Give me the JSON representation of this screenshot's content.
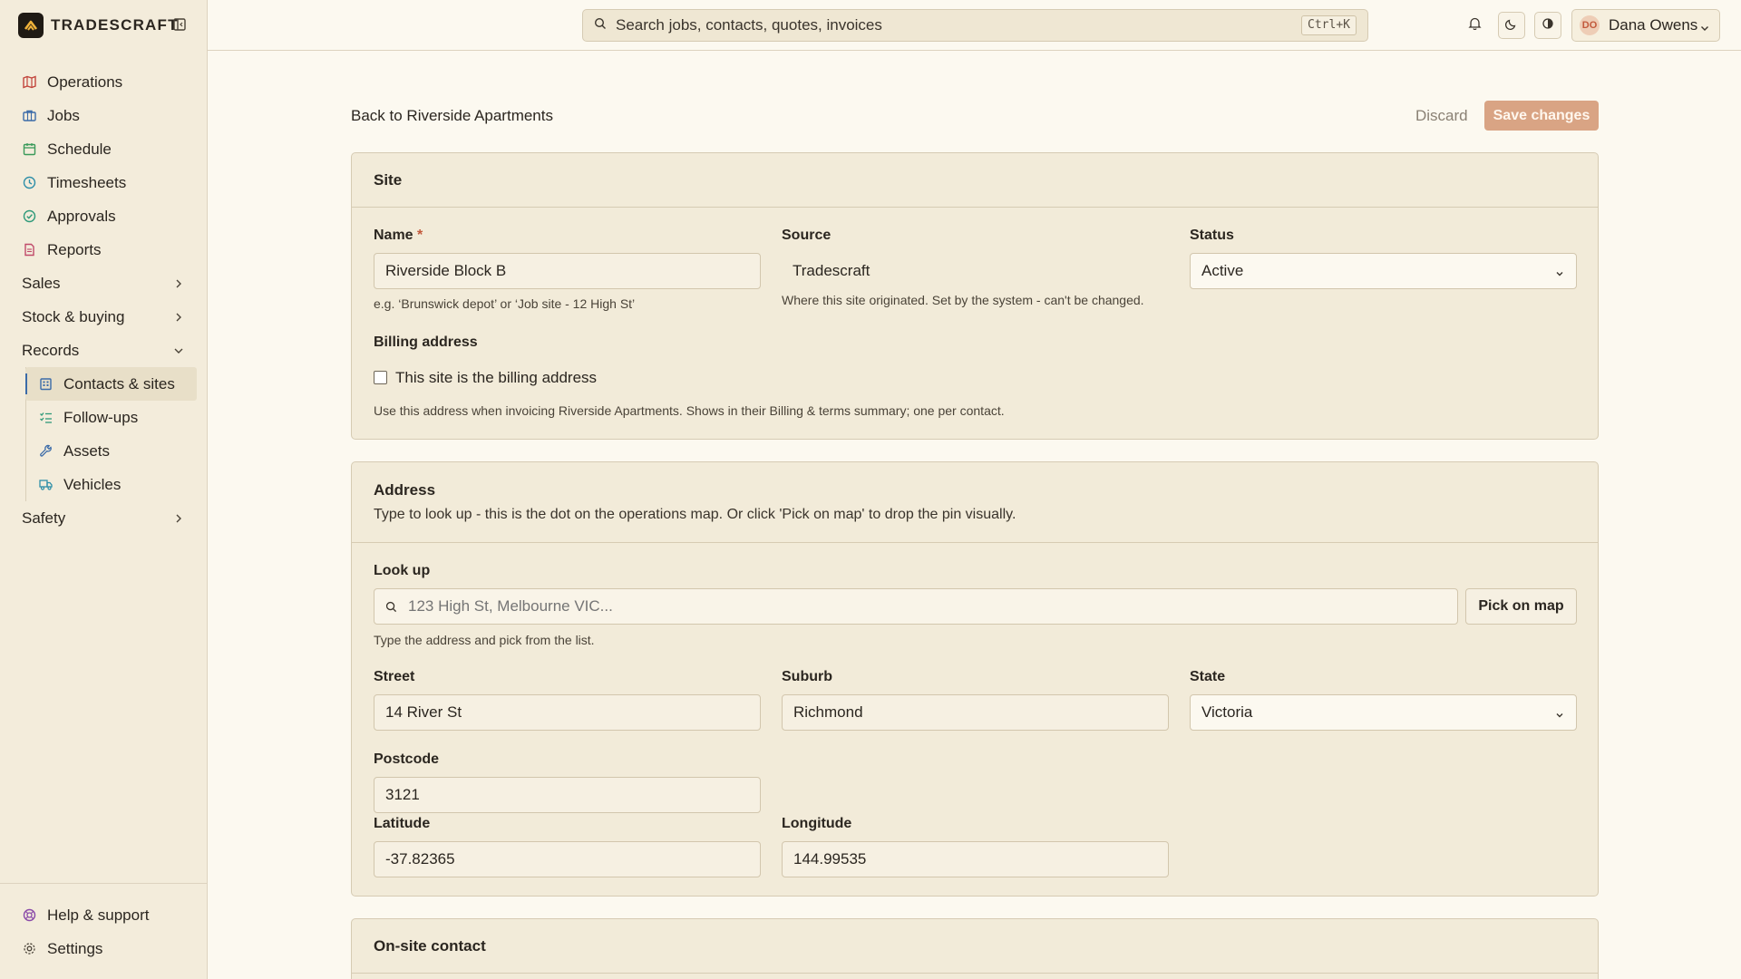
{
  "brand": {
    "name": "TRADESCRAFT"
  },
  "sidebar": {
    "items": [
      {
        "label": "Operations",
        "icon": "map-icon",
        "color": "#c2453c"
      },
      {
        "label": "Jobs",
        "icon": "briefcase-icon",
        "color": "#3b6ba8"
      },
      {
        "label": "Schedule",
        "icon": "calendar-icon",
        "color": "#3a9a5a"
      },
      {
        "label": "Timesheets",
        "icon": "clock-icon",
        "color": "#2f8fa8"
      },
      {
        "label": "Approvals",
        "icon": "check-circle-icon",
        "color": "#2f9a7a"
      },
      {
        "label": "Reports",
        "icon": "report-icon",
        "color": "#c04a6a"
      }
    ],
    "groups": {
      "sales": "Sales",
      "stock": "Stock & buying",
      "records": "Records",
      "safety": "Safety"
    },
    "records_items": [
      {
        "label": "Contacts & sites",
        "icon": "building-icon"
      },
      {
        "label": "Follow-ups",
        "icon": "checklist-icon"
      },
      {
        "label": "Assets",
        "icon": "wrench-icon"
      },
      {
        "label": "Vehicles",
        "icon": "truck-icon"
      }
    ],
    "bottom": {
      "help": "Help & support",
      "settings": "Settings"
    }
  },
  "topbar": {
    "search_placeholder": "Search jobs, contacts, quotes, invoices",
    "shortcut": "Ctrl+K",
    "user": {
      "initials": "DO",
      "name": "Dana Owens"
    }
  },
  "page": {
    "back_label": "Back to Riverside Apartments",
    "discard_label": "Discard",
    "save_label": "Save changes"
  },
  "site": {
    "title": "Site",
    "name_label": "Name",
    "required_mark": "*",
    "name_value": "Riverside Block B",
    "name_hint": "e.g. ‘Brunswick depot’ or ‘Job site - 12 High St’",
    "source_label": "Source",
    "source_value": "Tradescraft",
    "source_hint": "Where this site originated. Set by the system - can't be changed.",
    "status_label": "Status",
    "status_value": "Active",
    "billing_label": "Billing address",
    "billing_checkbox": "This site is the billing address",
    "billing_hint": "Use this address when invoicing Riverside Apartments. Shows in their Billing & terms summary; one per contact."
  },
  "address": {
    "title": "Address",
    "description": "Type to look up - this is the dot on the operations map. Or click 'Pick on map' to drop the pin visually.",
    "lookup_label": "Look up",
    "lookup_placeholder": "123 High St, Melbourne VIC...",
    "pick_label": "Pick on map",
    "lookup_hint": "Type the address and pick from the list.",
    "street_label": "Street",
    "street_value": "14 River St",
    "suburb_label": "Suburb",
    "suburb_value": "Richmond",
    "state_label": "State",
    "state_value": "Victoria",
    "postcode_label": "Postcode",
    "postcode_value": "3121",
    "latitude_label": "Latitude",
    "latitude_value": "-37.82365",
    "longitude_label": "Longitude",
    "longitude_value": "144.99535"
  },
  "contact": {
    "title": "On-site contact"
  }
}
